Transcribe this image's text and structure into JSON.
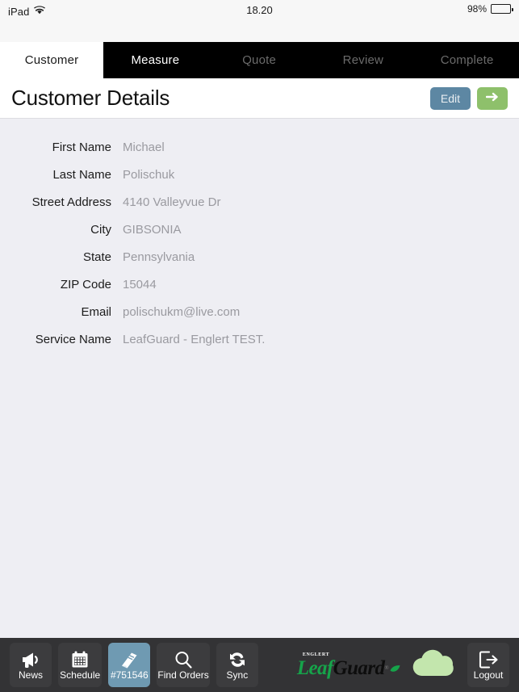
{
  "statusbar": {
    "device": "iPad",
    "wifi_icon": "wifi-icon",
    "time": "18.20",
    "battery_percent": "98%",
    "battery_icon": "battery-icon"
  },
  "steps": {
    "tabs": [
      {
        "label": "Customer",
        "state": "active"
      },
      {
        "label": "Measure",
        "state": "available"
      },
      {
        "label": "Quote",
        "state": "disabled"
      },
      {
        "label": "Review",
        "state": "disabled"
      },
      {
        "label": "Complete",
        "state": "disabled"
      }
    ]
  },
  "header": {
    "title": "Customer Details",
    "edit_label": "Edit",
    "next_icon": "arrow-right-icon"
  },
  "customer": {
    "fields": [
      {
        "label": "First Name",
        "value": "Michael"
      },
      {
        "label": "Last Name",
        "value": "Polischuk"
      },
      {
        "label": "Street Address",
        "value": "4140 Valleyvue Dr"
      },
      {
        "label": "City",
        "value": "GIBSONIA"
      },
      {
        "label": "State",
        "value": "Pennsylvania"
      },
      {
        "label": "ZIP Code",
        "value": "15044"
      },
      {
        "label": "Email",
        "value": "polischukm@live.com"
      },
      {
        "label": "Service Name",
        "value": "LeafGuard - Englert TEST."
      }
    ]
  },
  "toolbar": {
    "buttons": [
      {
        "label": "News",
        "icon": "megaphone-icon",
        "selected": false
      },
      {
        "label": "Schedule",
        "icon": "calendar-icon",
        "selected": false
      },
      {
        "label": "#751546",
        "icon": "book-icon",
        "selected": true
      },
      {
        "label": "Find Orders",
        "icon": "search-icon",
        "selected": false
      },
      {
        "label": "Sync",
        "icon": "sync-icon",
        "selected": false
      }
    ],
    "logout_label": "Logout",
    "logout_icon": "logout-icon",
    "cloud_icon": "cloud-icon"
  },
  "brand": {
    "englert": "ENGLERT",
    "leaf": "Leaf",
    "guard": "Guard",
    "registered": "®"
  },
  "colors": {
    "tabbar_bg": "#000000",
    "content_bg": "#eeeef3",
    "edit_button": "#5d87a3",
    "next_button": "#8ec06b",
    "toolbar_bg": "#333335",
    "toolbar_button": "#3c3c3e",
    "toolbar_selected": "#6f9ab2",
    "cloud_green": "#c3e6ad",
    "logo_green": "#16a34a",
    "value_text": "#9a9aa0"
  }
}
